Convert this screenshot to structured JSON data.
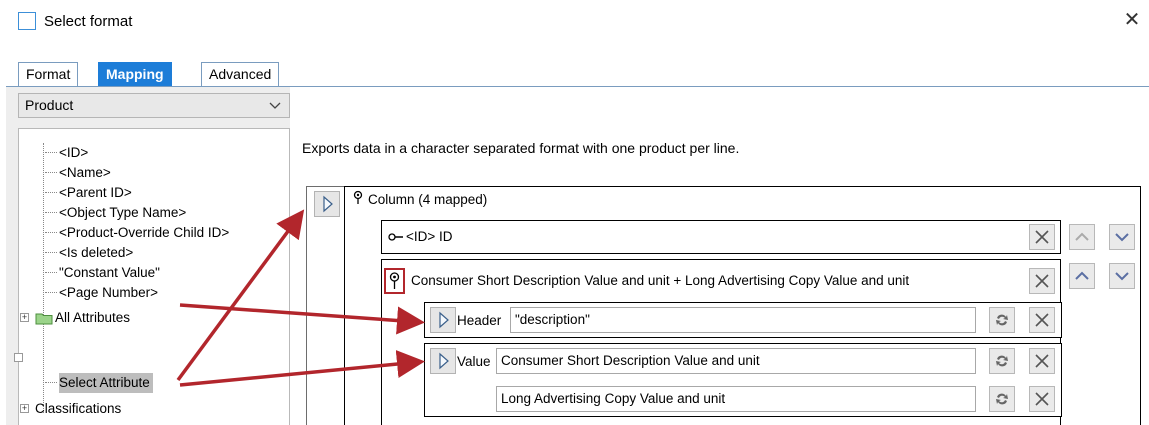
{
  "window": {
    "title": "Select format",
    "close_label": "✕"
  },
  "tabs": [
    {
      "label": "Format",
      "active": false
    },
    {
      "label": "Mapping",
      "active": true
    },
    {
      "label": "Advanced",
      "active": false
    }
  ],
  "object_type_select": {
    "value": "Product"
  },
  "tree": {
    "items": [
      {
        "label": "<ID>"
      },
      {
        "label": "<Name>"
      },
      {
        "label": "<Parent ID>"
      },
      {
        "label": "<Object Type Name>"
      },
      {
        "label": "<Product-Override Child ID>"
      },
      {
        "label": "<Is deleted>"
      },
      {
        "label": "\"Constant Value\""
      },
      {
        "label": "<Page Number>"
      },
      {
        "label": "All Attributes",
        "expandable": true,
        "icon": "folder-icon"
      },
      {
        "label": "Select Attribute",
        "selected": true
      },
      {
        "label": "Classifications",
        "expandable": true
      }
    ]
  },
  "description": "Exports data in a character separated format with one product per line.",
  "column": {
    "label": "Column (4 mapped)",
    "rows": [
      {
        "label": "<ID> ID"
      },
      {
        "label": "Consumer Short Description Value and unit + Long Advertising Copy Value and unit"
      }
    ],
    "header": {
      "label": "Header",
      "value": "\"description\""
    },
    "value": {
      "label": "Value",
      "values": [
        "Consumer Short Description Value and unit",
        "Long Advertising Copy Value and unit"
      ]
    }
  },
  "colors": {
    "accent": "#1d7dd8",
    "annotation_arrow": "#b2262c"
  }
}
